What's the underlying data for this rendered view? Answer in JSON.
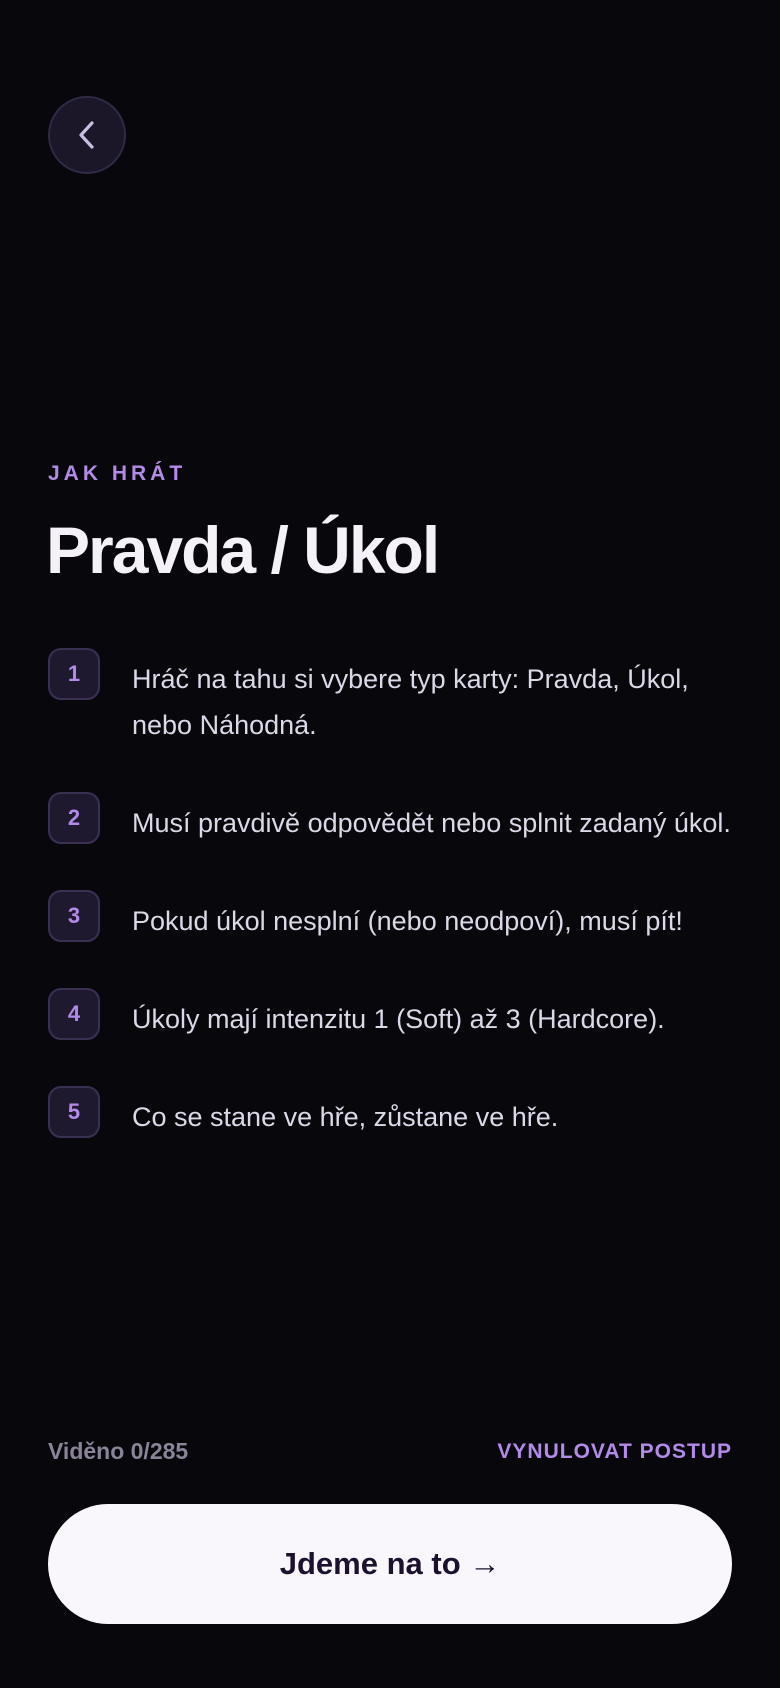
{
  "header": {
    "back_icon": "chevron-left-icon"
  },
  "intro": {
    "eyebrow": "JAK HRÁT",
    "title": "Pravda / Úkol"
  },
  "rules": [
    {
      "number": "1",
      "text": "Hráč na tahu si vybere typ karty: Pravda, Úkol, nebo Náhodná."
    },
    {
      "number": "2",
      "text": "Musí pravdivě odpovědět nebo splnit zadaný úkol."
    },
    {
      "number": "3",
      "text": "Pokud úkol nesplní (nebo neodpoví), musí pít!"
    },
    {
      "number": "4",
      "text": "Úkoly mají intenzitu 1 (Soft) až 3 (Hardcore)."
    },
    {
      "number": "5",
      "text": "Co se stane ve hře, zůstane ve hře."
    }
  ],
  "footer": {
    "seen_label": "Viděno 0/285",
    "reset_label": "VYNULOVAT POSTUP",
    "cta_label": "Jdeme na to →"
  },
  "colors": {
    "background": "#08070c",
    "accent": "#b48ae8",
    "cta_background": "#faf7fc",
    "cta_text": "#1c1230"
  }
}
